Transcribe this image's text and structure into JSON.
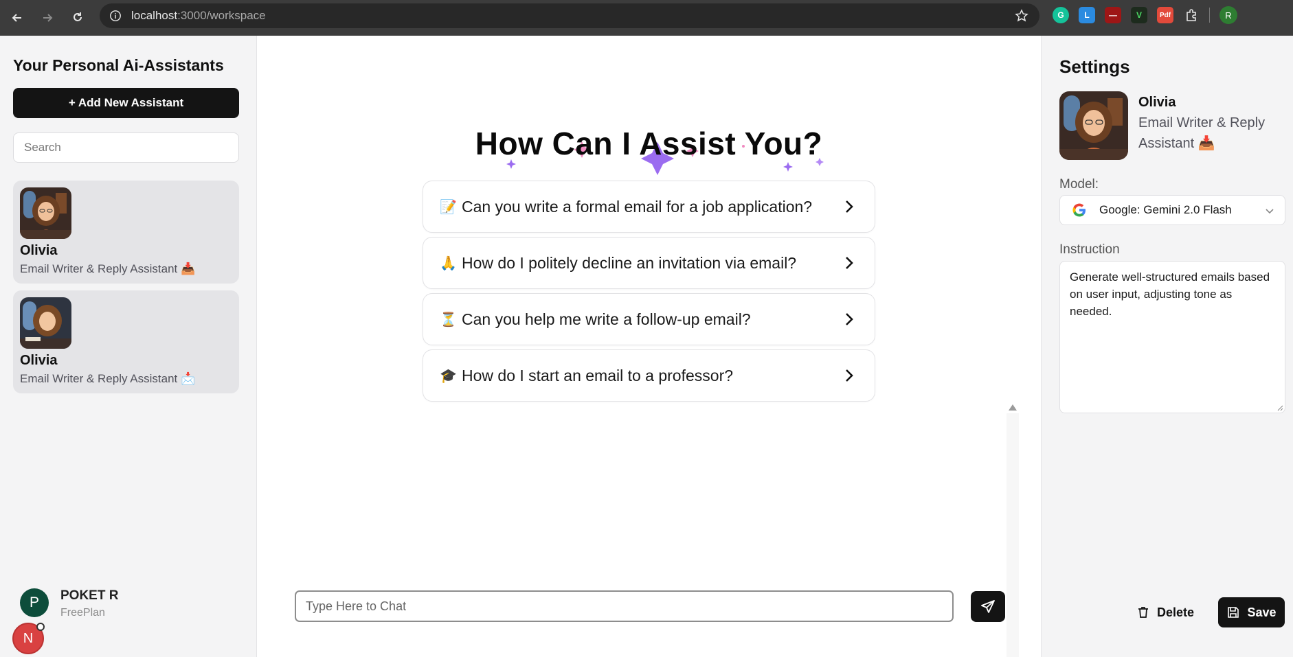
{
  "browser": {
    "url_host": "localhost",
    "url_rest": ":3000/workspace",
    "profile_initial": "R",
    "extensions": [
      "grammarly-icon",
      "lastpass-icon",
      "ublock-icon",
      "vim-icon",
      "pdf-icon",
      "extensions-puzzle-icon"
    ]
  },
  "sidebar": {
    "title": "Your Personal Ai-Assistants",
    "add_button": "+ Add New Assistant",
    "search_placeholder": "Search",
    "assistants": [
      {
        "name": "Olivia",
        "role": "Email Writer & Reply Assistant 📥"
      },
      {
        "name": "Olivia",
        "role": "Email Writer & Reply Assistant 📩"
      }
    ],
    "user": {
      "initial": "P",
      "name": "POKET R",
      "plan": "FreePlan"
    },
    "badge_initial": "N"
  },
  "main": {
    "headline": "How Can I Assist You?",
    "suggestions": [
      {
        "emoji": "📝",
        "text": "Can you write a formal email for a job application?"
      },
      {
        "emoji": "🙏",
        "text": "How do I politely decline an invitation via email?"
      },
      {
        "emoji": "⏳",
        "text": "Can you help me write a follow-up email?"
      },
      {
        "emoji": "🎓",
        "text": "How do I start an email to a professor?"
      }
    ],
    "input_placeholder": "Type Here to Chat"
  },
  "settings": {
    "title": "Settings",
    "assistant_name": "Olivia",
    "assistant_role": "Email Writer & Reply Assistant 📥",
    "model_label": "Model:",
    "model_value": "Google: Gemini 2.0 Flash",
    "instruction_label": "Instruction",
    "instruction_text": "Generate well-structured emails based on user input, adjusting tone as needed.",
    "delete_label": "Delete",
    "save_label": "Save"
  },
  "colors": {
    "primary_button": "#141414",
    "sidebar_bg": "#f4f4f5",
    "card_bg": "#e4e4e7",
    "user_avatar": "#0d4d3b",
    "badge": "#d94141",
    "sparkle_purple": "#9b6cf0",
    "sparkle_pink": "#f08ac0"
  }
}
